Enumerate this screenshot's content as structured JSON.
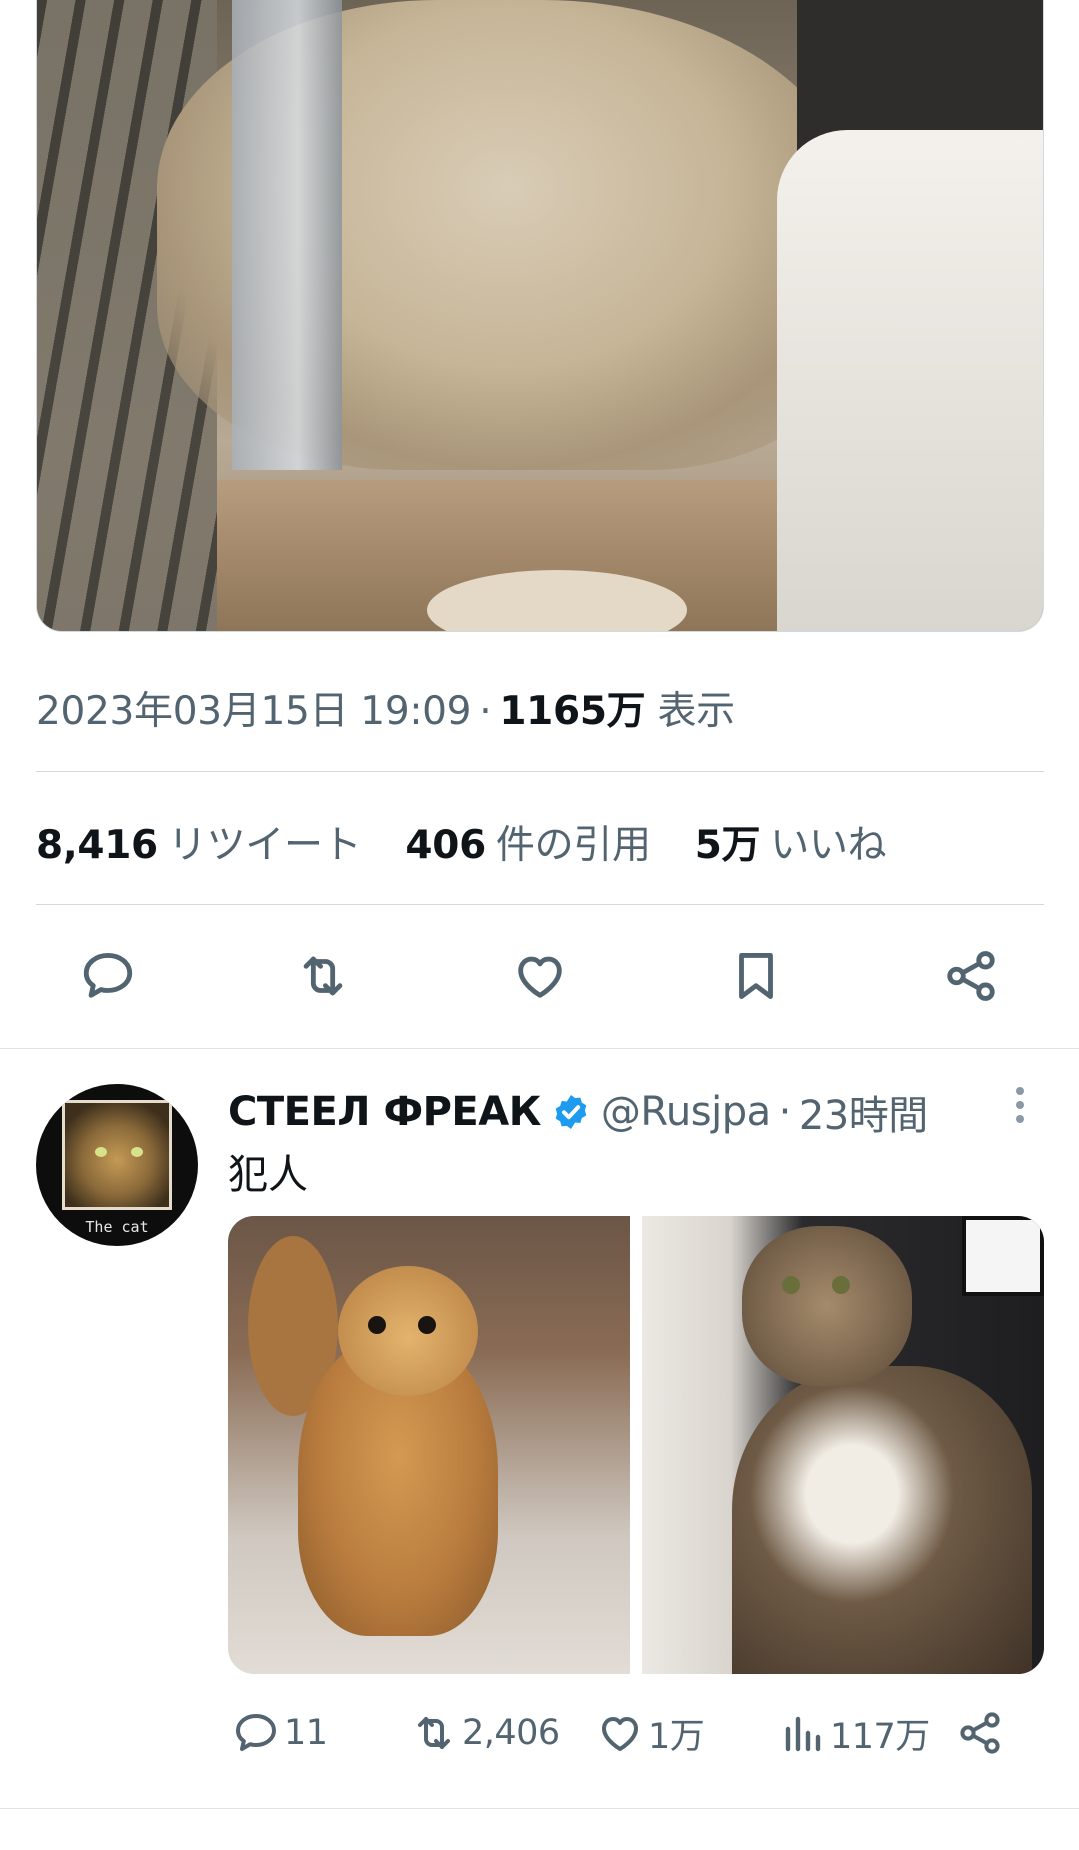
{
  "tweet": {
    "timestamp": "2023年03月15日 19:09",
    "separator": "·",
    "views_count": "1165万",
    "views_label": "表示",
    "stats": {
      "retweets_count": "8,416",
      "retweets_label": "リツイート",
      "quotes_count": "406",
      "quotes_label": "件の引用",
      "likes_count": "5万",
      "likes_label": "いいね"
    },
    "actions": [
      {
        "icon": "reply-icon"
      },
      {
        "icon": "retweet-icon"
      },
      {
        "icon": "like-icon"
      },
      {
        "icon": "bookmark-icon"
      },
      {
        "icon": "share-icon"
      }
    ]
  },
  "reply": {
    "display_name": "СТЕЕЛ ФРЕАК",
    "verified": true,
    "handle": "@Rusjpa",
    "separator": "·",
    "time_ago": "23時間",
    "text": "犯人",
    "avatar_caption": "The cat",
    "media_count": 2,
    "counts": {
      "replies": "11",
      "retweets": "2,406",
      "likes": "1万",
      "views": "117万"
    }
  },
  "colors": {
    "text_primary": "#0f1419",
    "text_secondary": "#536471",
    "divider": "#cfd9de",
    "verified_blue": "#1d9bf0"
  }
}
